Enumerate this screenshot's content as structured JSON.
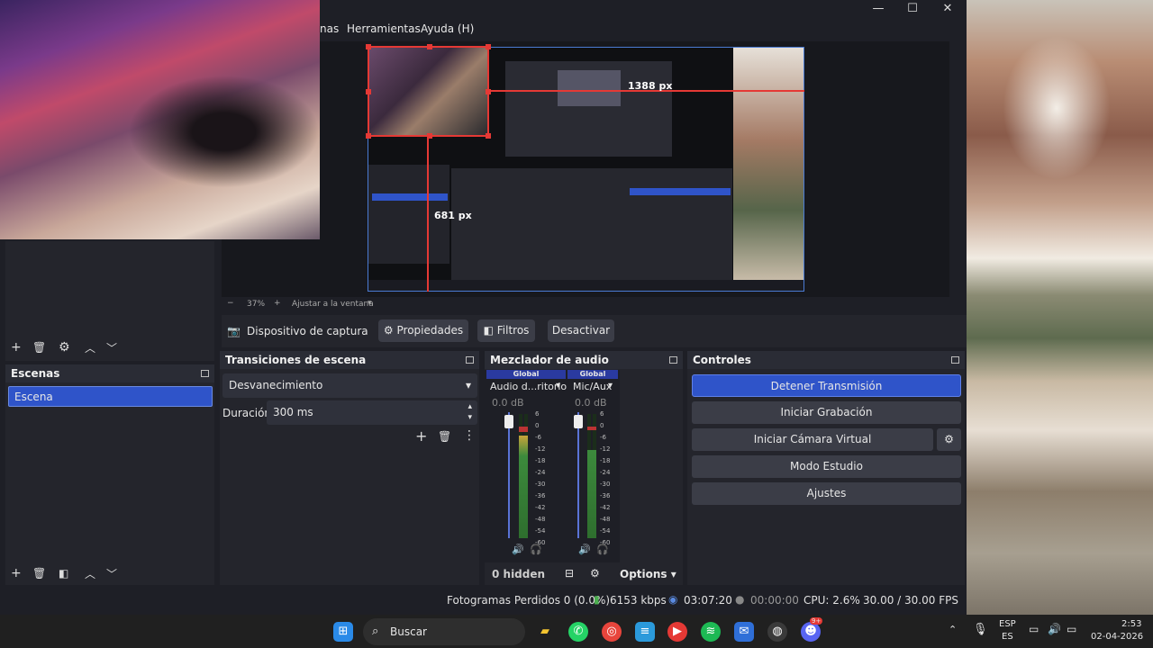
{
  "window": {
    "menu_partial": "nas",
    "menu_tools": "Herramientas",
    "menu_help": "Ayuda (H)",
    "minimize_glyph": "—",
    "maximize_glyph": "☐",
    "close_glyph": "✕"
  },
  "preview": {
    "width_label": "1388 px",
    "height_label": "681 px",
    "zoom_value": "37%",
    "zoom_fit": "Ajustar a la ventana"
  },
  "source_toolbar": {
    "source_name": "Dispositivo de captura de v",
    "properties": "Propiedades",
    "filters": "Filtros",
    "deactivate": "Desactivar"
  },
  "scenes": {
    "title": "Escenas",
    "items": [
      "Escena"
    ]
  },
  "transitions": {
    "title": "Transiciones de escena",
    "selected": "Desvanecimiento",
    "duration_label": "Duración",
    "duration_value": "300 ms"
  },
  "mixer": {
    "title": "Mezclador de audio",
    "channels": [
      {
        "badge": "Global",
        "name": "Audio d...ritorio",
        "db": "0.0 dB"
      },
      {
        "badge": "Global",
        "name": "Mic/Aux",
        "db": "0.0 dB"
      }
    ],
    "scale": [
      "6",
      "0",
      "-6",
      "-12",
      "-18",
      "-24",
      "-30",
      "-36",
      "-42",
      "-48",
      "-54",
      "-60"
    ],
    "hidden": "0 hidden",
    "options": "Options"
  },
  "controls": {
    "title": "Controles",
    "stop_stream": "Detener Transmisión",
    "start_recording": "Iniciar Grabación",
    "start_virtual_cam": "Iniciar Cámara Virtual",
    "studio_mode": "Modo Estudio",
    "settings": "Ajustes"
  },
  "status": {
    "dropped": "Fotogramas Perdidos 0 (0.0%)",
    "bitrate": "6153 kbps",
    "stream_time": "03:07:20",
    "rec_time": "00:00:00",
    "cpu": "CPU: 2.6%",
    "fps": "30.00 / 30.00 FPS"
  },
  "taskbar": {
    "search": "Buscar",
    "lang_top": "ESP",
    "lang_bottom": "ES",
    "time": "2:53",
    "date": "02-04-2026",
    "discord_badge": "9+"
  },
  "colors": {
    "accent": "#2f54c9",
    "record_red": "#e53935"
  }
}
